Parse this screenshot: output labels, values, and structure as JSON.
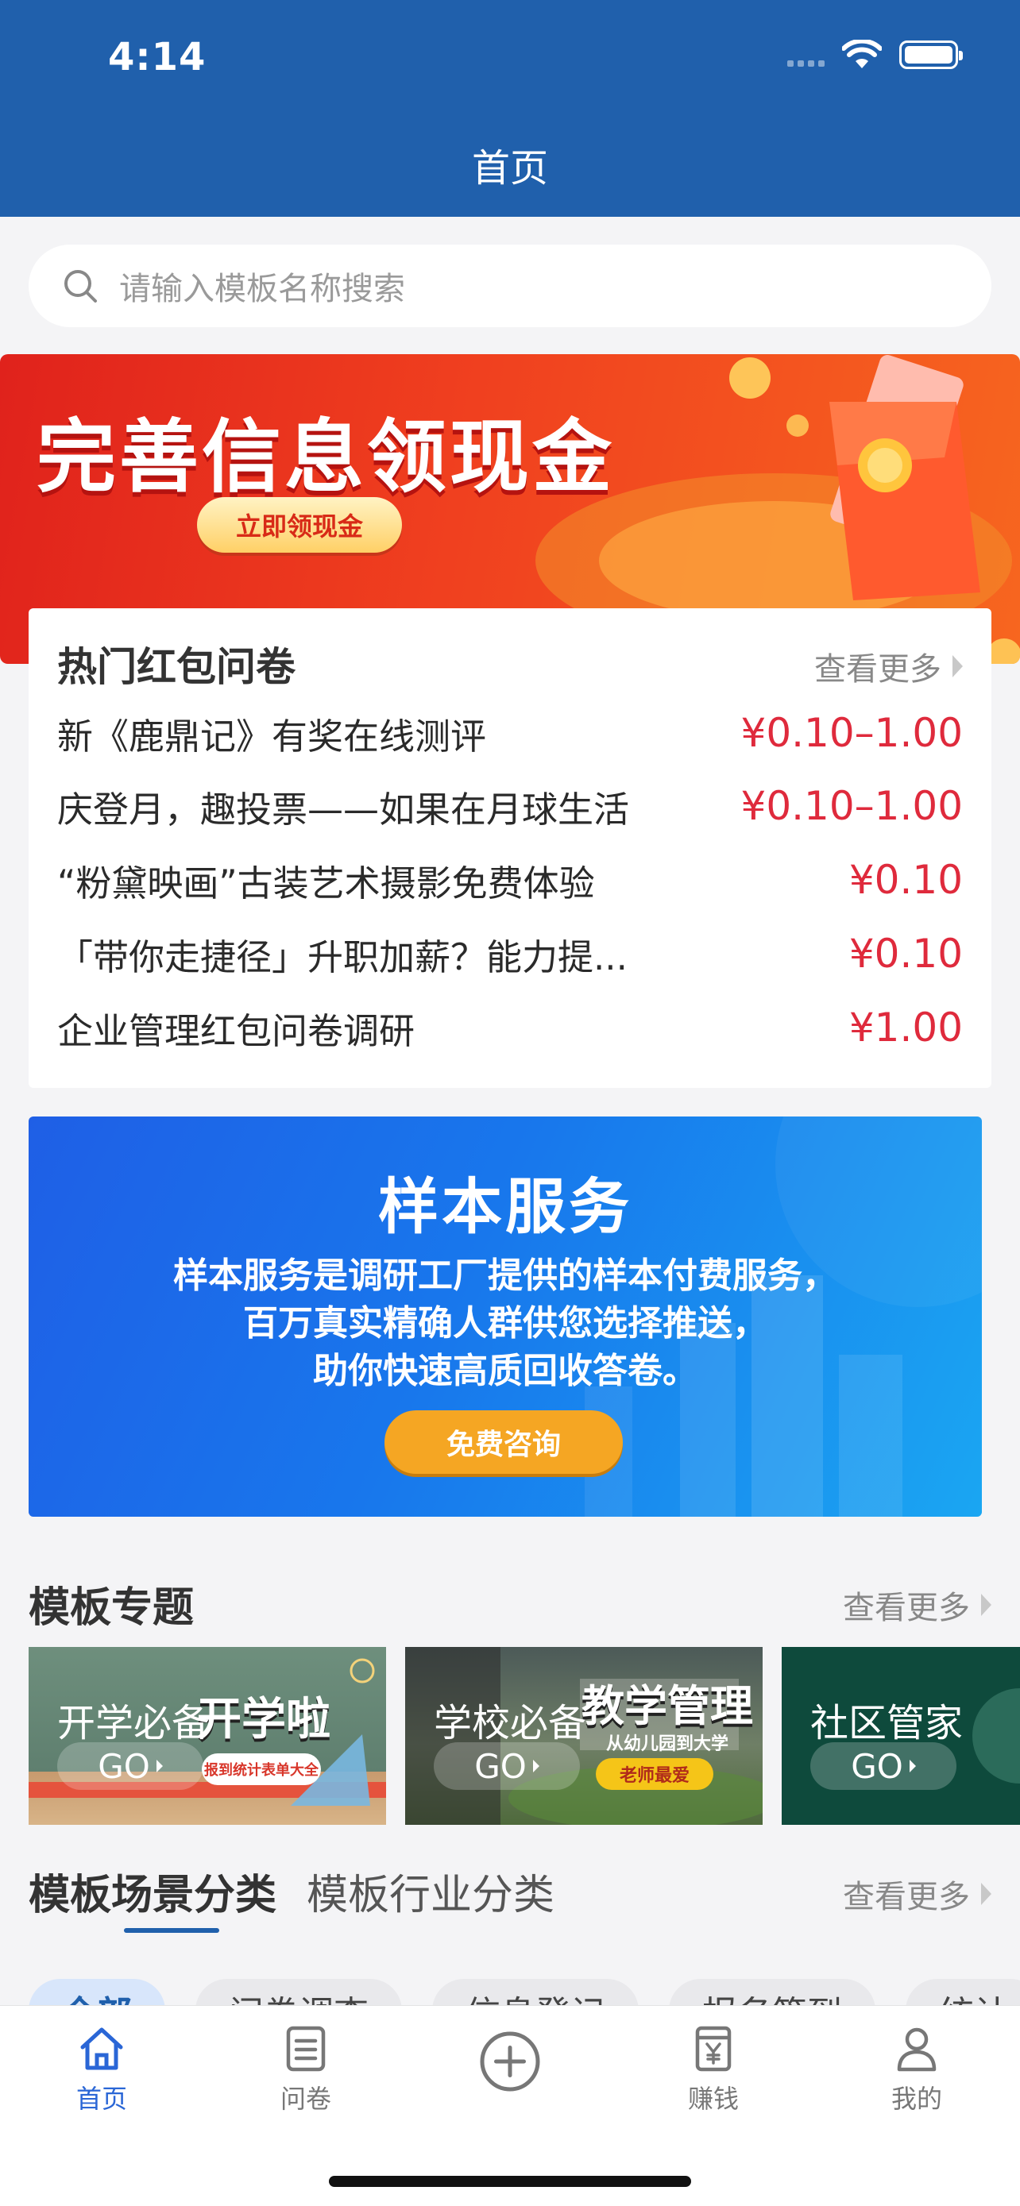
{
  "status_bar": {
    "time": "4:14"
  },
  "header": {
    "title": "首页"
  },
  "search": {
    "placeholder": "请输入模板名称搜索"
  },
  "banner_cash": {
    "title": "完善信息领现金",
    "button_label": "立即领现金"
  },
  "hot_surveys": {
    "title": "热门红包问卷",
    "see_more": "查看更多",
    "items": [
      {
        "title": "新《鹿鼎记》有奖在线测评",
        "price": "¥0.10–1.00"
      },
      {
        "title": "庆登月，趣投票——如果在月球生活",
        "price": "¥0.10–1.00"
      },
      {
        "title": "“粉黛映画”古装艺术摄影免费体验",
        "price": "¥0.10"
      },
      {
        "title": "「带你走捷径」升职加薪？能力提...",
        "price": "¥0.10"
      },
      {
        "title": "企业管理红包问卷调研",
        "price": "¥1.00"
      }
    ]
  },
  "banner_sample": {
    "title": "样本服务",
    "line1": "样本服务是调研工厂提供的样本付费服务，",
    "line2": "百万真实精确人群供您选择推送，",
    "line3": "助你快速高质回收答卷。",
    "button_label": "免费咨询"
  },
  "template_topics": {
    "title": "模板专题",
    "see_more": "查看更多",
    "cards": [
      {
        "label": "开学必备",
        "go": "GO",
        "big_text": "开学啦",
        "tag": "报到统计表单大全"
      },
      {
        "label": "学校必备",
        "go": "GO",
        "big_text": "教学管理",
        "tag1": "从幼儿园到大学",
        "tag2": "老师最爱"
      },
      {
        "label": "社区管家",
        "go": "GO"
      }
    ]
  },
  "categories": {
    "tabs": [
      "模板场景分类",
      "模板行业分类"
    ],
    "see_more": "查看更多",
    "chips": [
      "全部",
      "问卷调查",
      "信息登记",
      "报名签到",
      "统计"
    ]
  },
  "tabbar": {
    "items": [
      {
        "label": "首页",
        "icon": "home-icon"
      },
      {
        "label": "问卷",
        "icon": "document-icon"
      },
      {
        "label": "",
        "icon": "add-circle-icon"
      },
      {
        "label": "赚钱",
        "icon": "yen-icon"
      },
      {
        "label": "我的",
        "icon": "user-icon"
      }
    ]
  },
  "colors": {
    "brand": "#2060ac",
    "price": "#df2a3c",
    "tab_active": "#2a66d6"
  }
}
